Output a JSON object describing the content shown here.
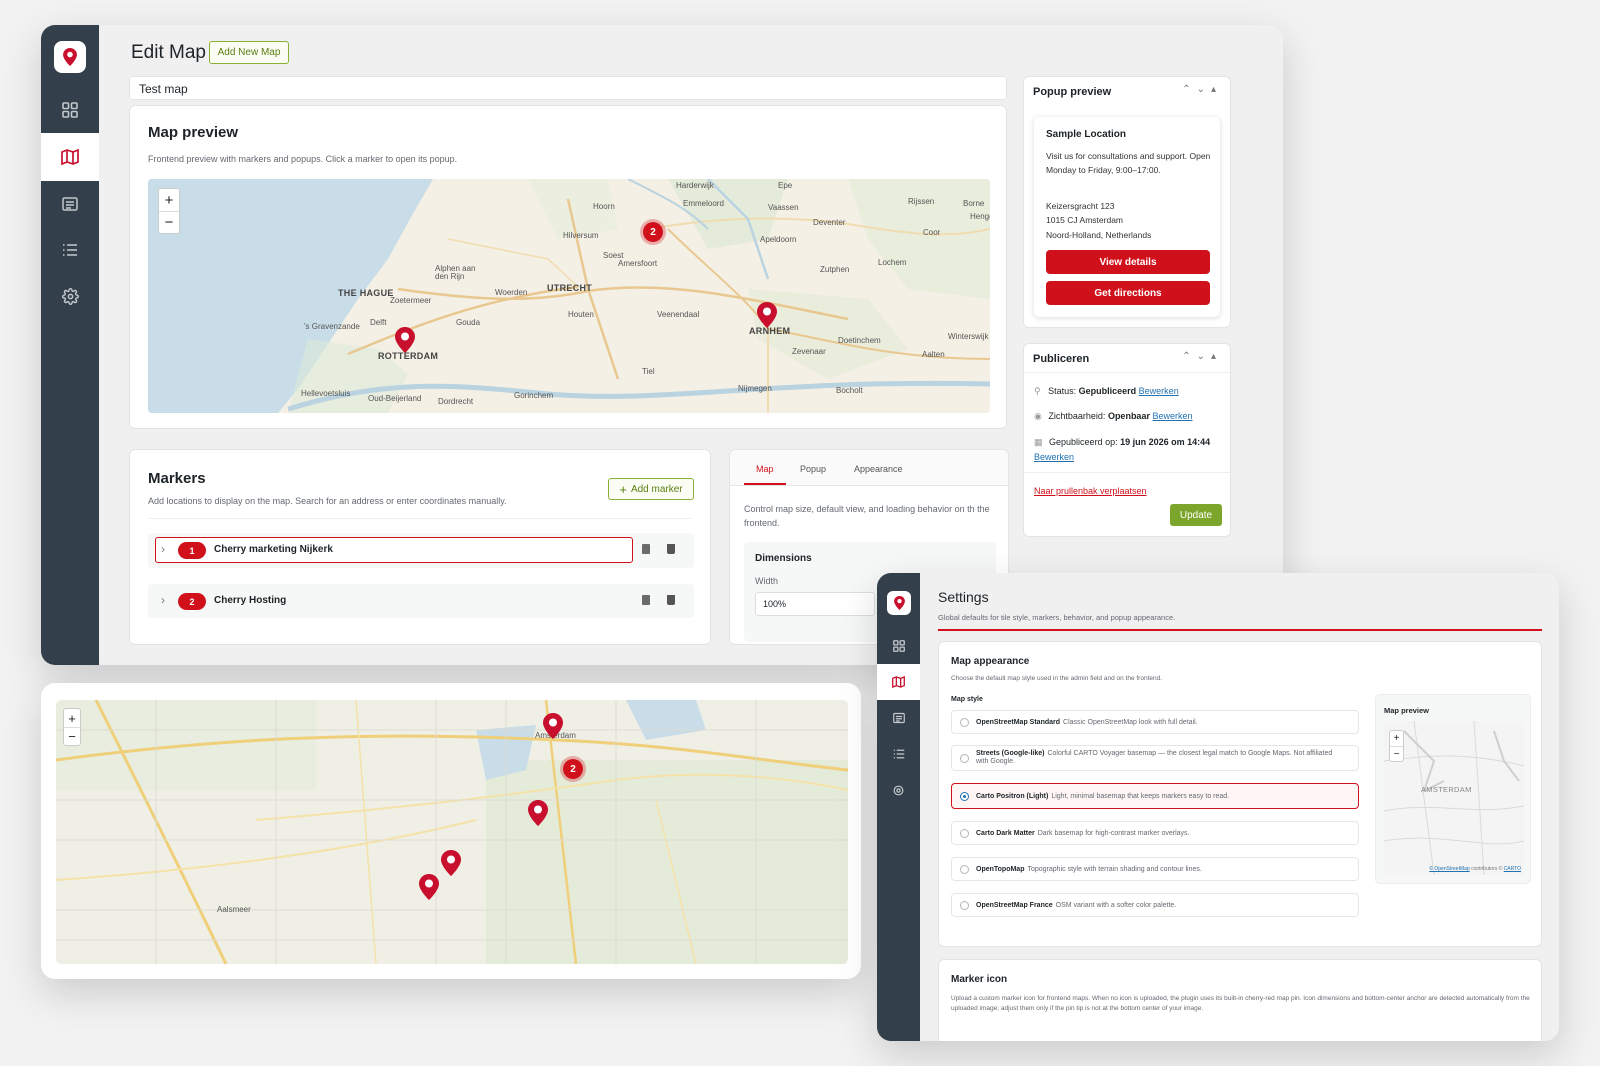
{
  "edit": {
    "title": "Edit Map",
    "add_new": "Add New Map",
    "map_name": "Test map",
    "preview": {
      "title": "Map preview",
      "desc": "Frontend preview with markers and popups. Click a marker to open its popup."
    },
    "map": {
      "cities": [
        "Harderwijk",
        "Epe",
        "Hoorn",
        "Emmeloord",
        "Vaassen",
        "Deventer",
        "Rijssen",
        "Borne",
        "Hengelo",
        "Hilversum",
        "Soest",
        "Amersfoort",
        "Apeldoorn",
        "Coor",
        "Lochem",
        "Zutphen",
        "Alphen aan den Rijn",
        "Woerden",
        "Houten",
        "Veenendaal",
        "Zoetermeer",
        "'s Gravenzande",
        "Delft",
        "Gouda",
        "Doetinchem",
        "Winterswijk",
        "Zevenaar",
        "Aalten",
        "Tiel",
        "Nijmegen",
        "Hellevoetsluis",
        "Oud-Beijerland",
        "Dordrecht",
        "Gorinchem",
        "Bocholt"
      ],
      "big_cities": [
        "THE HAGUE",
        "UTRECHT",
        "ROTTERDAM",
        "ARNHEM"
      ],
      "cluster": "2"
    },
    "markers": {
      "title": "Markers",
      "desc": "Add locations to display on the map. Search for an address or enter coordinates manually.",
      "add": "Add marker",
      "items": [
        {
          "num": "1",
          "name": "Cherry marketing Nijkerk"
        },
        {
          "num": "2",
          "name": "Cherry Hosting"
        }
      ]
    },
    "tabs": {
      "items": [
        "Map",
        "Popup",
        "Appearance"
      ],
      "desc": "Control map size, default view, and loading behavior on th the frontend.",
      "dimensions": "Dimensions",
      "width_label": "Width",
      "width_value": "100%"
    },
    "popup": {
      "title": "Popup preview",
      "loc": "Sample Location",
      "text": "Visit us for consultations and support. Open Monday to Friday, 9:00–17:00.",
      "addr1": "Keizersgracht 123",
      "addr2": "1015 CJ Amsterdam",
      "addr3": "Noord-Holland, Netherlands",
      "btn1": "View details",
      "btn2": "Get directions"
    },
    "publish": {
      "title": "Publiceren",
      "status_label": "Status:",
      "status_value": "Gepubliceerd",
      "visibility_label": "Zichtbaarheid:",
      "visibility_value": "Openbaar",
      "date_label": "Gepubliceerd op:",
      "date_value": "19 jun 2026 om",
      "time_value": "14:44",
      "edit": "Bewerken",
      "trash": "Naar prullenbak verplaatsen",
      "update": "Update"
    }
  },
  "city_map": {
    "cluster": "2",
    "label_top": "Amsterdam",
    "label_left": "Aalsmeer"
  },
  "settings": {
    "title": "Settings",
    "desc": "Global defaults for tile style, markers, behavior, and popup appearance.",
    "appearance": {
      "title": "Map appearance",
      "desc": "Choose the default map style used in the admin field and on the frontend.",
      "style_label": "Map style",
      "options": [
        {
          "name": "OpenStreetMap Standard",
          "desc": "Classic OpenStreetMap look with full detail."
        },
        {
          "name": "Streets (Google-like)",
          "desc": "Colorful CARTO Voyager basemap — the closest legal match to Google Maps. Not affiliated with Google."
        },
        {
          "name": "Carto Positron (Light)",
          "desc": "Light, minimal basemap that keeps markers easy to read."
        },
        {
          "name": "Carto Dark Matter",
          "desc": "Dark basemap for high-contrast marker overlays."
        },
        {
          "name": "OpenTopoMap",
          "desc": "Topographic style with terrain shading and contour lines."
        },
        {
          "name": "OpenStreetMap France",
          "desc": "OSM variant with a softer color palette."
        }
      ],
      "selected": 2
    },
    "preview": {
      "title": "Map preview",
      "city": "AMSTERDAM",
      "osm": "© OpenStreetMap",
      "contrib": "contributors ©",
      "carto": "CARTO"
    },
    "marker_icon": {
      "title": "Marker icon",
      "desc": "Upload a custom marker icon for frontend maps. When no icon is uploaded, the plugin uses its built-in cherry-red map pin. Icon dimensions and bottom-center anchor are detected automatically from the uploaded image; adjust them only if the pin tip is not at the bottom center of your image."
    }
  },
  "colors": {
    "accent": "#d0111b",
    "sidebar": "#333f4a",
    "link": "#2271b1",
    "green": "#8bb036"
  }
}
